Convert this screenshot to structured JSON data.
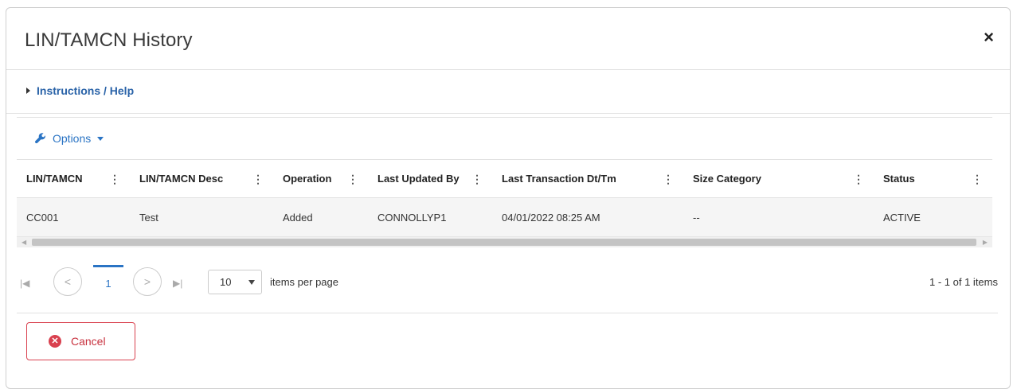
{
  "dialog": {
    "title": "LIN/TAMCN History",
    "close_glyph": "×",
    "help_link": "Instructions / Help"
  },
  "toolbar": {
    "options_label": "Options",
    "options_icon": "wrench-icon"
  },
  "table": {
    "columns": [
      {
        "label": "LIN/TAMCN"
      },
      {
        "label": "LIN/TAMCN Desc"
      },
      {
        "label": "Operation"
      },
      {
        "label": "Last Updated By"
      },
      {
        "label": "Last Transaction Dt/Tm"
      },
      {
        "label": "Size Category"
      },
      {
        "label": "Status"
      }
    ],
    "rows": [
      [
        "CC001",
        "Test",
        "Added",
        "CONNOLLYP1",
        "04/01/2022 08:25 AM",
        "--",
        "ACTIVE"
      ]
    ]
  },
  "pager": {
    "current_page": "1",
    "page_size": "10",
    "page_size_label": "items per page",
    "count_text": "1 - 1 of 1 items"
  },
  "footer": {
    "cancel_label": "Cancel"
  },
  "colors": {
    "link": "#2a63a8",
    "accent": "#2a74c4",
    "danger": "#d9414f"
  }
}
